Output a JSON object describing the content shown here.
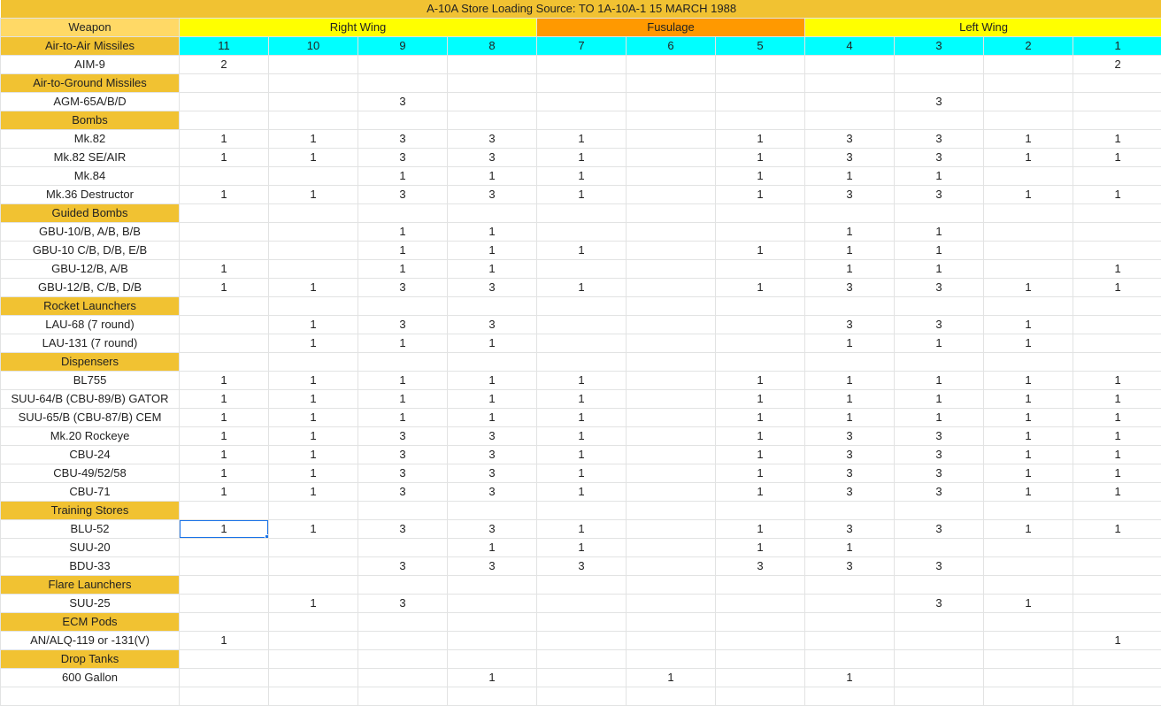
{
  "title": "A-10A Store Loading   Source: TO 1A-10A-1 15 MARCH 1988",
  "header": {
    "weapon_label": "Weapon",
    "groups": [
      {
        "label": "Right Wing",
        "span": 4,
        "color": "#ffff00"
      },
      {
        "label": "Fusulage",
        "span": 3,
        "color": "#ff9900"
      },
      {
        "label": "Left Wing",
        "span": 4,
        "color": "#ffff00"
      }
    ]
  },
  "stations": [
    "11",
    "10",
    "9",
    "8",
    "7",
    "6",
    "5",
    "4",
    "3",
    "2",
    "1"
  ],
  "colors": {
    "title_bg": "#f1c232",
    "weapon_header_bg": "#ffd966",
    "category_bg": "#f1c232",
    "station_bg": "#00ffff",
    "selection": "#1a73e8"
  },
  "rows": [
    {
      "type": "category",
      "label": "Air-to-Air Missiles"
    },
    {
      "type": "item",
      "label": "AIM-9",
      "values": [
        "2",
        "",
        "",
        "",
        "",
        "",
        "",
        "",
        "",
        "",
        "2"
      ]
    },
    {
      "type": "category",
      "label": "Air-to-Ground Missiles"
    },
    {
      "type": "item",
      "label": "AGM-65A/B/D",
      "values": [
        "",
        "",
        "3",
        "",
        "",
        "",
        "",
        "",
        "3",
        "",
        ""
      ]
    },
    {
      "type": "category",
      "label": "Bombs"
    },
    {
      "type": "item",
      "label": "Mk.82",
      "values": [
        "1",
        "1",
        "3",
        "3",
        "1",
        "",
        "1",
        "3",
        "3",
        "1",
        "1"
      ]
    },
    {
      "type": "item",
      "label": "Mk.82 SE/AIR",
      "values": [
        "1",
        "1",
        "3",
        "3",
        "1",
        "",
        "1",
        "3",
        "3",
        "1",
        "1"
      ]
    },
    {
      "type": "item",
      "label": "Mk.84",
      "values": [
        "",
        "",
        "1",
        "1",
        "1",
        "",
        "1",
        "1",
        "1",
        "",
        ""
      ]
    },
    {
      "type": "item",
      "label": "Mk.36 Destructor",
      "values": [
        "1",
        "1",
        "3",
        "3",
        "1",
        "",
        "1",
        "3",
        "3",
        "1",
        "1"
      ]
    },
    {
      "type": "category",
      "label": "Guided Bombs"
    },
    {
      "type": "item",
      "label": "GBU-10/B, A/B, B/B",
      "values": [
        "",
        "",
        "1",
        "1",
        "",
        "",
        "",
        "1",
        "1",
        "",
        ""
      ]
    },
    {
      "type": "item",
      "label": "GBU-10 C/B, D/B, E/B",
      "values": [
        "",
        "",
        "1",
        "1",
        "1",
        "",
        "1",
        "1",
        "1",
        "",
        ""
      ]
    },
    {
      "type": "item",
      "label": "GBU-12/B, A/B",
      "values": [
        "1",
        "",
        "1",
        "1",
        "",
        "",
        "",
        "1",
        "1",
        "",
        "1"
      ]
    },
    {
      "type": "item",
      "label": "GBU-12/B, C/B, D/B",
      "values": [
        "1",
        "1",
        "3",
        "3",
        "1",
        "",
        "1",
        "3",
        "3",
        "1",
        "1"
      ]
    },
    {
      "type": "category",
      "label": "Rocket Launchers"
    },
    {
      "type": "item",
      "label": "LAU-68 (7 round)",
      "values": [
        "",
        "1",
        "3",
        "3",
        "",
        "",
        "",
        "3",
        "3",
        "1",
        ""
      ]
    },
    {
      "type": "item",
      "label": "LAU-131 (7 round)",
      "values": [
        "",
        "1",
        "1",
        "1",
        "",
        "",
        "",
        "1",
        "1",
        "1",
        ""
      ]
    },
    {
      "type": "category",
      "label": "Dispensers"
    },
    {
      "type": "item",
      "label": "BL755",
      "values": [
        "1",
        "1",
        "1",
        "1",
        "1",
        "",
        "1",
        "1",
        "1",
        "1",
        "1"
      ]
    },
    {
      "type": "item",
      "label": "SUU-64/B (CBU-89/B) GATOR",
      "values": [
        "1",
        "1",
        "1",
        "1",
        "1",
        "",
        "1",
        "1",
        "1",
        "1",
        "1"
      ]
    },
    {
      "type": "item",
      "label": "SUU-65/B (CBU-87/B) CEM",
      "values": [
        "1",
        "1",
        "1",
        "1",
        "1",
        "",
        "1",
        "1",
        "1",
        "1",
        "1"
      ]
    },
    {
      "type": "item",
      "label": "Mk.20 Rockeye",
      "values": [
        "1",
        "1",
        "3",
        "3",
        "1",
        "",
        "1",
        "3",
        "3",
        "1",
        "1"
      ]
    },
    {
      "type": "item",
      "label": "CBU-24",
      "values": [
        "1",
        "1",
        "3",
        "3",
        "1",
        "",
        "1",
        "3",
        "3",
        "1",
        "1"
      ]
    },
    {
      "type": "item",
      "label": "CBU-49/52/58",
      "values": [
        "1",
        "1",
        "3",
        "3",
        "1",
        "",
        "1",
        "3",
        "3",
        "1",
        "1"
      ]
    },
    {
      "type": "item",
      "label": "CBU-71",
      "values": [
        "1",
        "1",
        "3",
        "3",
        "1",
        "",
        "1",
        "3",
        "3",
        "1",
        "1"
      ]
    },
    {
      "type": "category",
      "label": "Training Stores"
    },
    {
      "type": "item",
      "label": "BLU-52",
      "values": [
        "1",
        "1",
        "3",
        "3",
        "1",
        "",
        "1",
        "3",
        "3",
        "1",
        "1"
      ],
      "selected_col": 0
    },
    {
      "type": "item",
      "label": "SUU-20",
      "values": [
        "",
        "",
        "",
        "1",
        "1",
        "",
        "1",
        "1",
        "",
        "",
        ""
      ]
    },
    {
      "type": "item",
      "label": "BDU-33",
      "values": [
        "",
        "",
        "3",
        "3",
        "3",
        "",
        "3",
        "3",
        "3",
        "",
        ""
      ]
    },
    {
      "type": "category",
      "label": "Flare Launchers"
    },
    {
      "type": "item",
      "label": "SUU-25",
      "values": [
        "",
        "1",
        "3",
        "",
        "",
        "",
        "",
        "",
        "3",
        "1",
        ""
      ]
    },
    {
      "type": "category",
      "label": "ECM Pods"
    },
    {
      "type": "item",
      "label": "AN/ALQ-119 or -131(V)",
      "values": [
        "1",
        "",
        "",
        "",
        "",
        "",
        "",
        "",
        "",
        "",
        "1"
      ]
    },
    {
      "type": "category",
      "label": "Drop Tanks"
    },
    {
      "type": "item",
      "label": "600 Gallon",
      "values": [
        "",
        "",
        "",
        "1",
        "",
        "1",
        "",
        "1",
        "",
        "",
        ""
      ]
    },
    {
      "type": "empty"
    }
  ]
}
